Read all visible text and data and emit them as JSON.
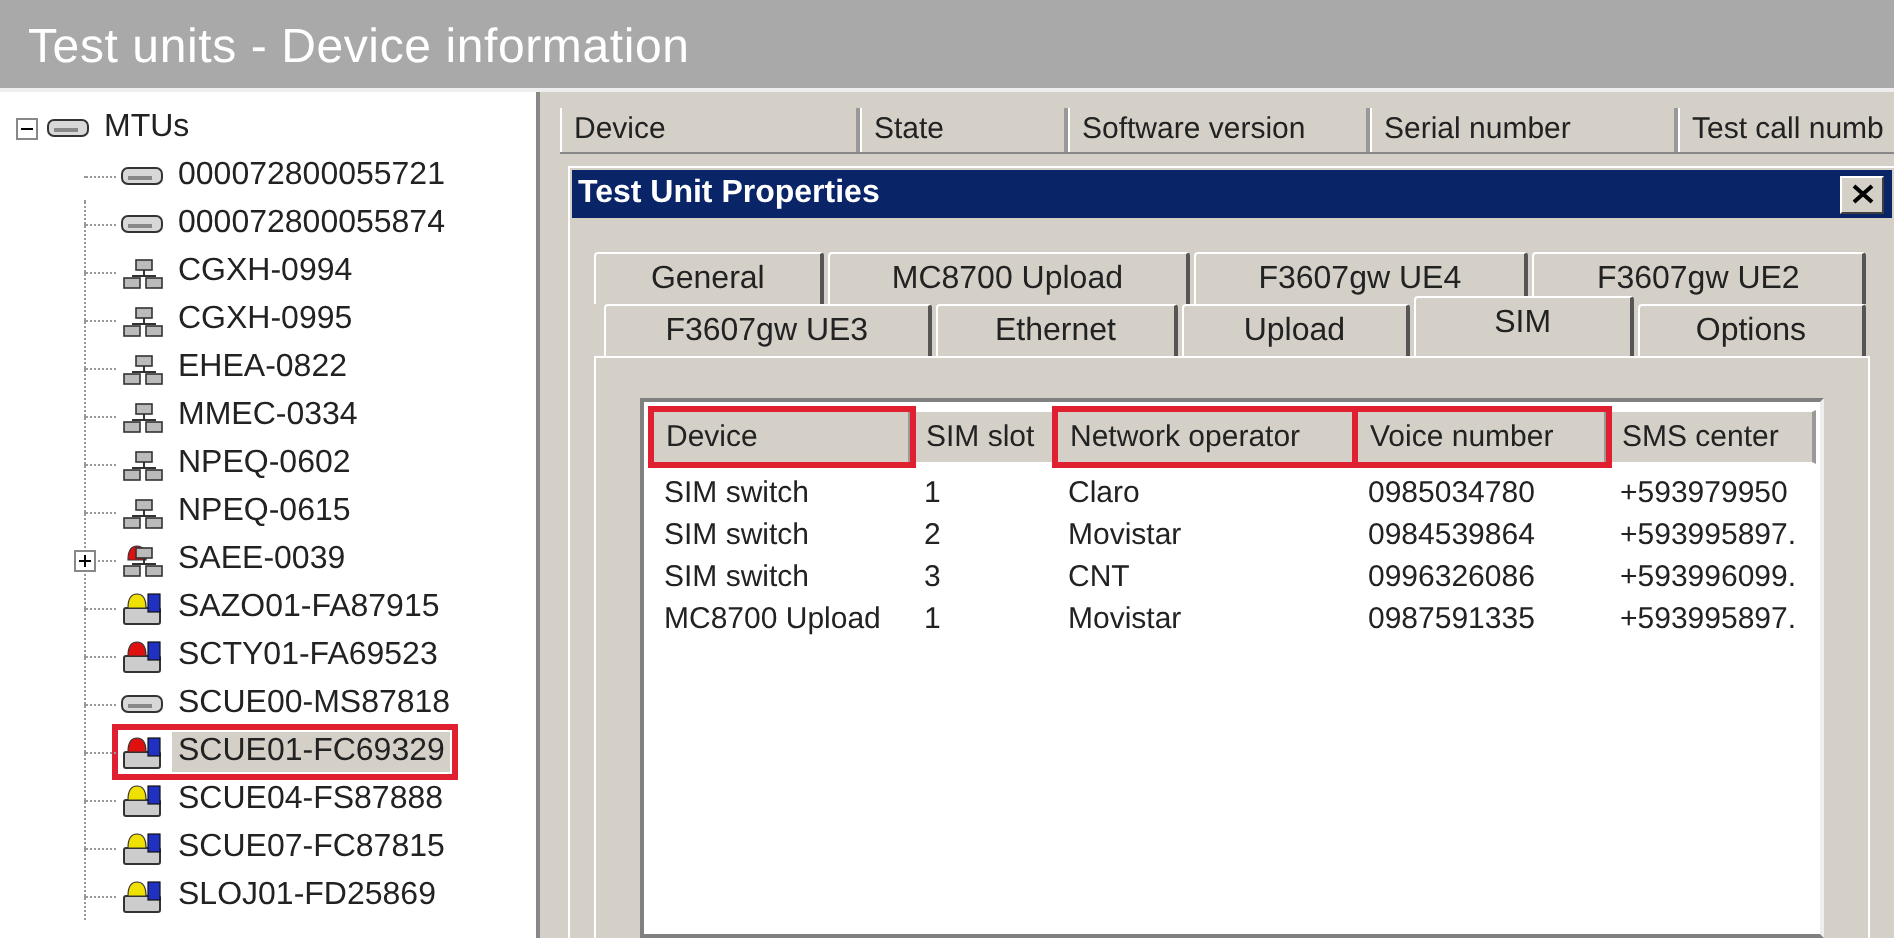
{
  "window": {
    "title": "Test units - Device information"
  },
  "tree": {
    "label": "MTUs",
    "kind": "drive",
    "expanded": true,
    "children": [
      {
        "label": "000072800055721",
        "kind": "drive",
        "selected": false,
        "highlighted": false
      },
      {
        "label": "000072800055874",
        "kind": "drive",
        "selected": false,
        "highlighted": false
      },
      {
        "label": "CGXH-0994",
        "kind": "network",
        "selected": false,
        "highlighted": false
      },
      {
        "label": "CGXH-0995",
        "kind": "network",
        "selected": false,
        "highlighted": false
      },
      {
        "label": "EHEA-0822",
        "kind": "network",
        "selected": false,
        "highlighted": false
      },
      {
        "label": "MMEC-0334",
        "kind": "network",
        "selected": false,
        "highlighted": false
      },
      {
        "label": "NPEQ-0602",
        "kind": "network",
        "selected": false,
        "highlighted": false
      },
      {
        "label": "NPEQ-0615",
        "kind": "network",
        "selected": false,
        "highlighted": false
      },
      {
        "label": "SAEE-0039",
        "kind": "network",
        "color": "#e01010",
        "expanded": false,
        "selected": false,
        "highlighted": false
      },
      {
        "label": "SAZO01-FA87915",
        "kind": "unit",
        "color": "#f0e000",
        "selected": false,
        "highlighted": false
      },
      {
        "label": "SCTY01-FA69523",
        "kind": "unit",
        "color": "#e01010",
        "selected": false,
        "highlighted": false
      },
      {
        "label": "SCUE00-MS87818",
        "kind": "drive",
        "selected": false,
        "highlighted": false
      },
      {
        "label": "SCUE01-FC69329",
        "kind": "unit",
        "color": "#e01010",
        "selected": true,
        "highlighted": true
      },
      {
        "label": "SCUE04-FS87888",
        "kind": "unit",
        "color": "#f0e000",
        "selected": false,
        "highlighted": false
      },
      {
        "label": "SCUE07-FC87815",
        "kind": "unit",
        "color": "#f0e000",
        "selected": false,
        "highlighted": false
      },
      {
        "label": "SLOJ01-FD25869",
        "kind": "unit",
        "color": "#f0e000",
        "selected": false,
        "highlighted": false
      }
    ]
  },
  "table": {
    "columns": [
      "Device",
      "State",
      "Software version",
      "Serial number",
      "Test call numb"
    ]
  },
  "dialog": {
    "title": "Test Unit Properties",
    "tab_rows": [
      [
        {
          "label": "General",
          "selected": false
        },
        {
          "label": "MC8700 Upload",
          "selected": false
        },
        {
          "label": "F3607gw UE4",
          "selected": false
        },
        {
          "label": "F3607gw UE2",
          "selected": false
        }
      ],
      [
        {
          "label": "F3607gw UE3",
          "selected": false
        },
        {
          "label": "Ethernet",
          "selected": false
        },
        {
          "label": "Upload",
          "selected": false
        },
        {
          "label": "SIM",
          "selected": true
        },
        {
          "label": "Options",
          "selected": false
        }
      ]
    ],
    "sim_table": {
      "columns": [
        {
          "label": "Device",
          "highlighted": true
        },
        {
          "label": "SIM slot",
          "highlighted": false
        },
        {
          "label": "Network operator",
          "highlighted": true
        },
        {
          "label": "Voice number",
          "highlighted": true
        },
        {
          "label": "SMS center",
          "highlighted": false
        }
      ],
      "rows": [
        [
          "SIM switch",
          "1",
          "Claro",
          "0985034780",
          "+593979950"
        ],
        [
          "SIM switch",
          "2",
          "Movistar",
          "0984539864",
          "+593995897."
        ],
        [
          "SIM switch",
          "3",
          "CNT",
          "0996326086",
          "+593996099."
        ],
        [
          "MC8700 Upload",
          "1",
          "Movistar",
          "0987591335",
          "+593995897."
        ]
      ]
    }
  }
}
